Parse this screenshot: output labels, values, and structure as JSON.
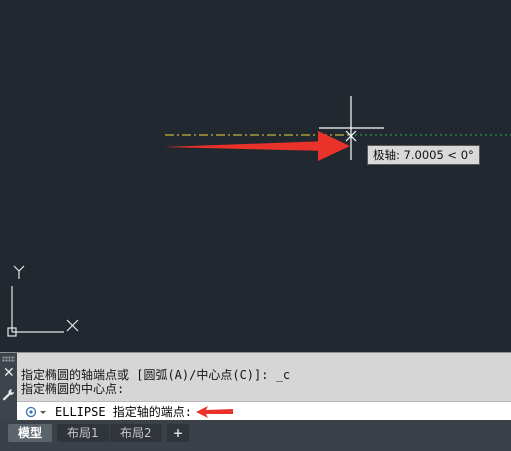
{
  "drawing": {
    "tooltip": "极轴: 7.0005 < 0°",
    "ucs_x_label": "X",
    "ucs_y_label": "Y"
  },
  "command_line": {
    "history_line_1": "指定椭圆的轴端点或 [圆弧(A)/中心点(C)]: _c",
    "history_line_2": "指定椭圆的中心点:",
    "current_prompt": "ELLIPSE 指定轴的端点:"
  },
  "layout_tabs": {
    "model": "模型",
    "layout1": "布局1",
    "layout2": "布局2",
    "add": "+"
  },
  "colors": {
    "canvas_bg": "#212830",
    "annotation_arrow": "#e8322a",
    "tracking_line_yellow": "#c8b43c",
    "tracking_line_green": "#2fa84a"
  }
}
